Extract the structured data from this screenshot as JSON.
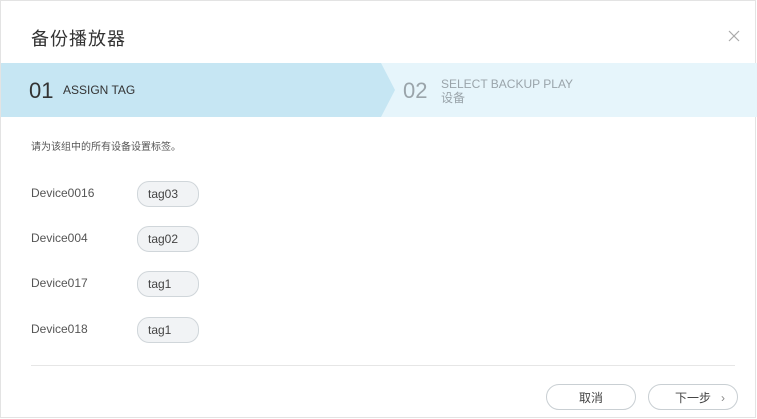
{
  "dialog": {
    "title": "备份播放器",
    "close_icon": "close-icon"
  },
  "steps": [
    {
      "number": "01",
      "label": "ASSIGN TAG",
      "active": true
    },
    {
      "number": "02",
      "label_line1": "SELECT BACKUP PLAY",
      "label_line2": "设备",
      "active": false
    }
  ],
  "instruction": "请为该组中的所有设备设置标签。",
  "devices": [
    {
      "name": "Device0016",
      "tag": "tag03"
    },
    {
      "name": "Device004",
      "tag": "tag02"
    },
    {
      "name": "Device017",
      "tag": "tag1"
    },
    {
      "name": "Device018",
      "tag": "tag1"
    }
  ],
  "footer": {
    "cancel_label": "取消",
    "next_label": "下一步",
    "next_icon": "chevron-right-icon"
  },
  "colors": {
    "active_step_bg": "#c6e6f3",
    "inactive_step_bg": "#e6f5fb",
    "inactive_step_text": "#9aa4aa"
  }
}
